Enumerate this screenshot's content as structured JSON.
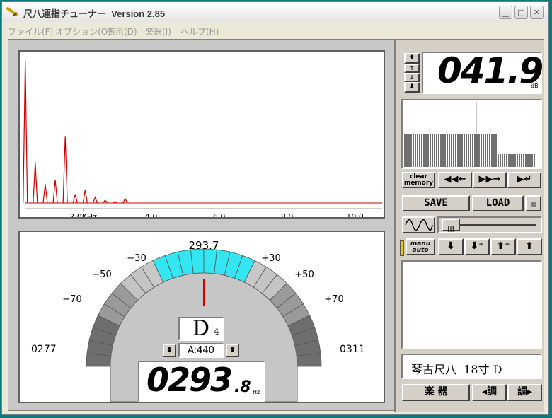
{
  "window": {
    "title": "尺八運指チューナー  Version 2.85",
    "controls": [
      "minimize",
      "maximize",
      "close"
    ]
  },
  "menu": [
    {
      "label": "ファイル(F)"
    },
    {
      "label": "オプション(O)"
    },
    {
      "label": "表示(D)"
    },
    {
      "label": "楽器(I)"
    },
    {
      "label": "ヘルプ(H)"
    }
  ],
  "spectrum": {
    "x_labels": [
      "2.0KHz",
      "4.0",
      "6.0",
      "8.0",
      "10.0"
    ],
    "line_color": "#cc0000"
  },
  "chart_data": {
    "type": "line",
    "x_labels": [
      "2.0KHz",
      "4.0",
      "6.0",
      "8.0",
      "10.0"
    ],
    "x_ticks": [
      2.0,
      4.0,
      6.0,
      8.0,
      10.0
    ],
    "xlim": [
      0.3,
      10.8
    ],
    "ylim": [
      0,
      1
    ],
    "peaks": [
      {
        "x": 0.294,
        "y": 0.98
      },
      {
        "x": 0.588,
        "y": 0.28
      },
      {
        "x": 0.882,
        "y": 0.13
      },
      {
        "x": 1.176,
        "y": 0.16
      },
      {
        "x": 1.47,
        "y": 0.46
      },
      {
        "x": 1.764,
        "y": 0.06
      },
      {
        "x": 2.058,
        "y": 0.09
      },
      {
        "x": 2.352,
        "y": 0.04
      },
      {
        "x": 2.646,
        "y": 0.02
      },
      {
        "x": 2.94,
        "y": 0.01
      },
      {
        "x": 3.234,
        "y": 0.03
      }
    ]
  },
  "gauge": {
    "center_freq": "293.7",
    "labels": [
      "−70",
      "−50",
      "−30",
      "+30",
      "+50",
      "+70"
    ],
    "low_freq": "0277",
    "high_freq": "0311",
    "note": "D",
    "octave": "4",
    "a_ref": "A:440",
    "freq_int": "0293",
    "freq_dec": ".8",
    "freq_unit": "Hz",
    "active_color": "#33e6f2"
  },
  "level": {
    "value": "041.9",
    "unit": "dB"
  },
  "history_buttons": {
    "clear_line1": "clear",
    "clear_line2": "memory"
  },
  "save_label": "SAVE",
  "load_label": "LOAD",
  "manu_auto_line1": "manu",
  "manu_auto_line2": "auto",
  "instrument": {
    "name": "琴古尺八  18寸 D"
  },
  "bottom_buttons": {
    "instrument_label": "楽 器",
    "key_down_label": "◂調",
    "key_up_label": "調▸"
  }
}
